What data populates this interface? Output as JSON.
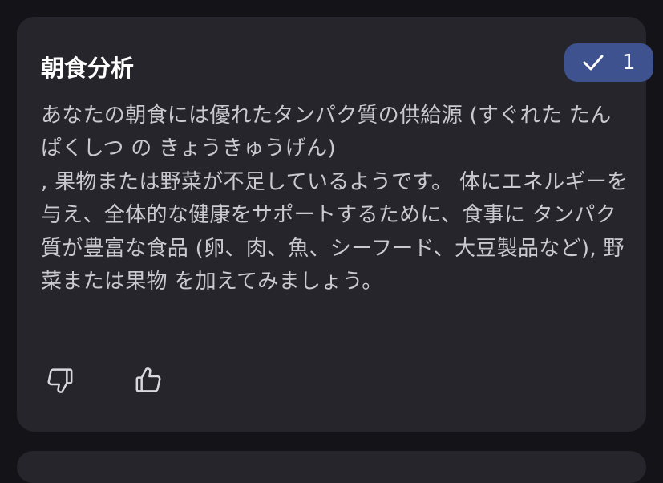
{
  "badge": {
    "icon": "check-icon",
    "count": "1"
  },
  "card": {
    "title": "朝食分析",
    "body": "あなたの朝食には優れたタンパク質の供給源 (すぐれた たんぱくしつ の きょうきゅうげん)\n, 果物または野菜が不足しているようです。 体にエネルギーを与え、全体的な健康をサポートするために、食事に タンパク質が豊富な食品 (卵、肉、魚、シーフード、大豆製品など), 野菜または果物 を加えてみましょう。"
  },
  "actions": {
    "dislike_icon": "thumbs-down-icon",
    "like_icon": "thumbs-up-icon"
  },
  "colors": {
    "background": "#141418",
    "card": "#25252b",
    "badge": "#3e5290",
    "title": "#ffffff",
    "body": "#c9c9cf"
  }
}
